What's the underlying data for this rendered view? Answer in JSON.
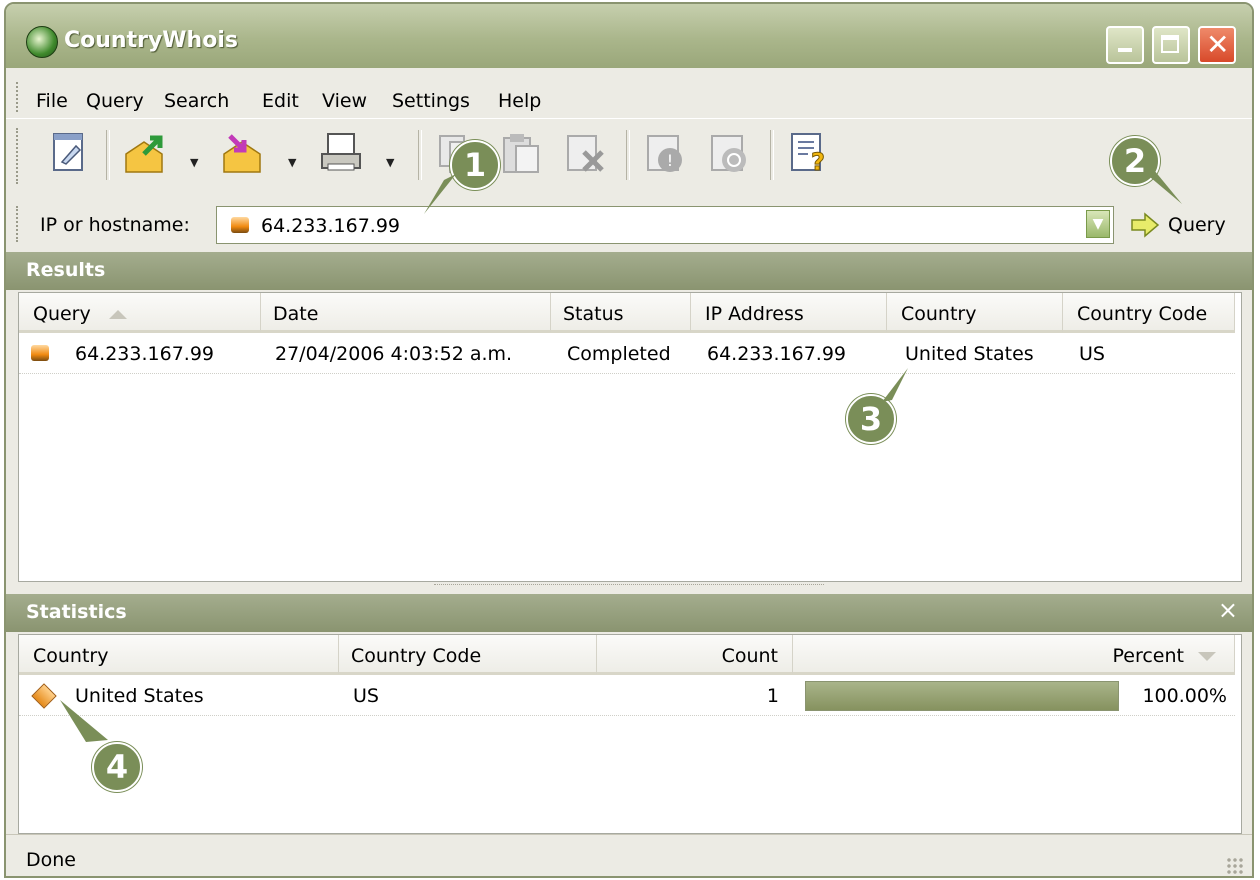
{
  "window": {
    "title": "CountryWhois"
  },
  "menu": [
    "File",
    "Query",
    "Search",
    "Edit",
    "View",
    "Settings",
    "Help"
  ],
  "toolbar": {
    "icons": [
      "new-query-icon",
      "import-icon",
      "export-icon",
      "print-icon",
      "copy-icon",
      "paste-icon",
      "delete-icon",
      "stop-icon",
      "refresh-icon",
      "help-icon"
    ]
  },
  "address": {
    "label": "IP or hostname:",
    "value": "64.233.167.99",
    "query_button": "Query"
  },
  "results": {
    "title": "Results",
    "columns": [
      "Query",
      "Date",
      "Status",
      "IP Address",
      "Country",
      "Country Code"
    ],
    "rows": [
      {
        "query": "64.233.167.99",
        "date": "27/04/2006 4:03:52 a.m.",
        "status": "Completed",
        "ip": "64.233.167.99",
        "country": "United States",
        "code": "US"
      }
    ]
  },
  "statistics": {
    "title": "Statistics",
    "close": "×",
    "columns": [
      "Country",
      "Country Code",
      "Count",
      "Percent"
    ],
    "rows": [
      {
        "country": "United States",
        "code": "US",
        "count": "1",
        "percent": "100.00%",
        "fraction": 1.0
      }
    ]
  },
  "callouts": [
    "1",
    "2",
    "3",
    "4"
  ],
  "status": {
    "text": "Done"
  },
  "colors": {
    "accent": "#8a9470",
    "callout": "#7a8e58",
    "bar": "#97a270"
  }
}
